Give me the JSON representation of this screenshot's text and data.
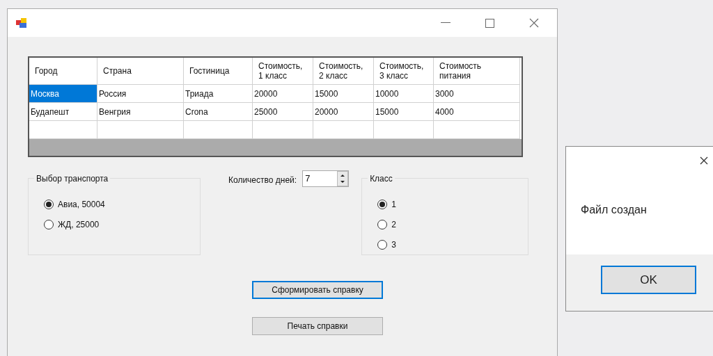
{
  "table": {
    "columns": [
      "Город",
      "Страна",
      "Гостиница",
      "Стоимость, 1 класс",
      "Стоимость, 2 класс",
      "Стоимость, 3 класс",
      "Стоимость питания"
    ],
    "rows": [
      {
        "cells": [
          {
            "text": "Москва",
            "selected": true
          },
          {
            "text": "Россия",
            "selected": false
          },
          {
            "text": "Триада",
            "selected": false
          },
          {
            "text": "20000",
            "selected": false
          },
          {
            "text": "15000",
            "selected": false
          },
          {
            "text": "10000",
            "selected": false
          },
          {
            "text": "3000",
            "selected": false
          }
        ]
      },
      {
        "cells": [
          {
            "text": "Будапешт",
            "selected": false
          },
          {
            "text": "Венгрия",
            "selected": false
          },
          {
            "text": "Crona",
            "selected": false
          },
          {
            "text": "25000",
            "selected": false
          },
          {
            "text": "20000",
            "selected": false
          },
          {
            "text": "15000",
            "selected": false
          },
          {
            "text": "4000",
            "selected": false
          }
        ]
      }
    ]
  },
  "transport": {
    "title": "Выбор транспорта",
    "options": [
      {
        "label": "Авиа, 50004",
        "selected": true
      },
      {
        "label": "ЖД, 25000",
        "selected": false
      }
    ]
  },
  "days": {
    "label": "Количество дней:",
    "value": "7"
  },
  "class_group": {
    "title": "Класс",
    "options": [
      {
        "label": "1",
        "selected": true
      },
      {
        "label": "2",
        "selected": false
      },
      {
        "label": "3",
        "selected": false
      }
    ]
  },
  "buttons": [
    {
      "label": "Сформировать справку",
      "focused": true
    },
    {
      "label": "Печать справки",
      "focused": false
    }
  ],
  "dialog": {
    "message": "Файл создан",
    "button": "OK"
  }
}
